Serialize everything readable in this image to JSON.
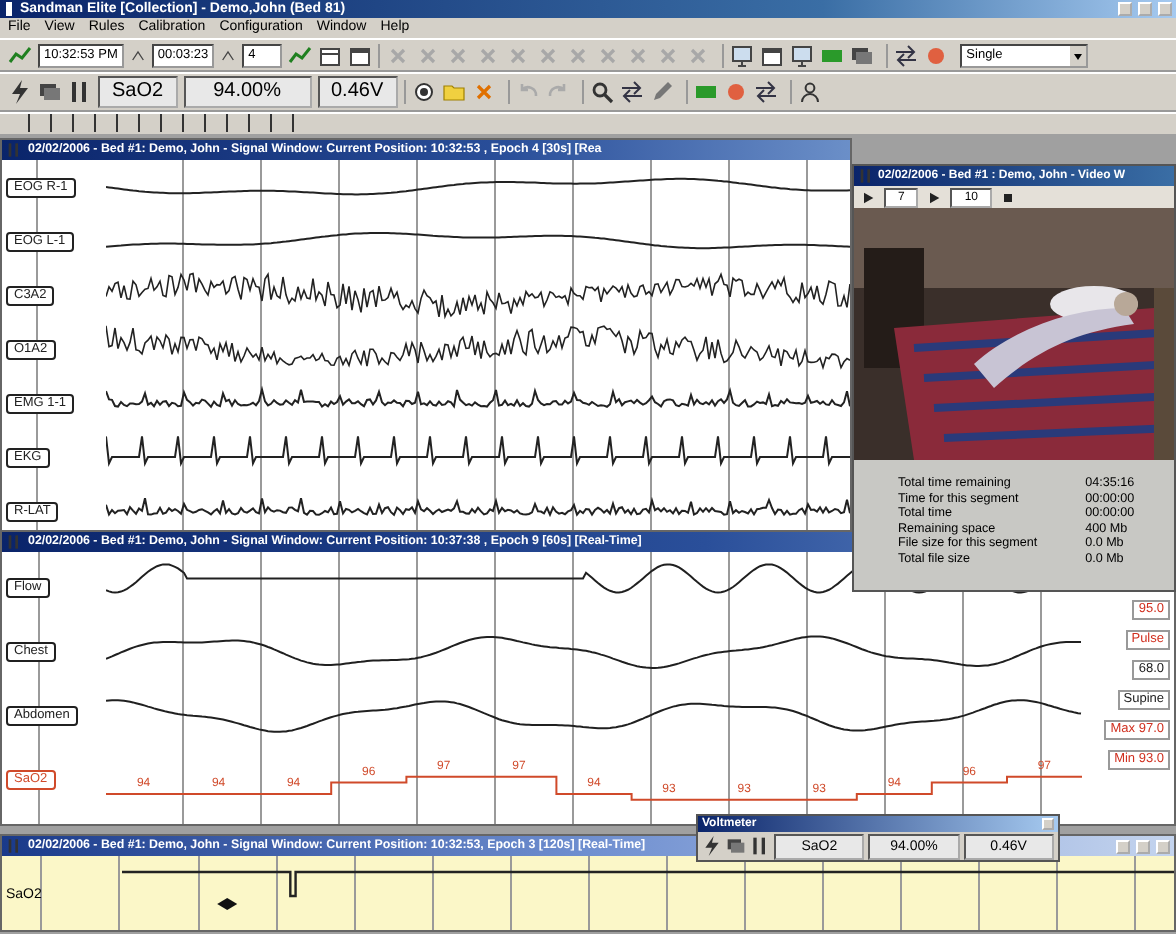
{
  "window": {
    "title": "Sandman Elite [Collection] - Demo,John (Bed 81)"
  },
  "menu": [
    "File",
    "View",
    "Rules",
    "Calibration",
    "Configuration",
    "Window",
    "Help"
  ],
  "toolbar": {
    "clock": "10:32:53 PM",
    "elapsed": "00:03:23",
    "epoch": "4",
    "layout": "Single"
  },
  "readout": {
    "channel": "SaO2",
    "value": "94.00%",
    "voltage": "0.46V"
  },
  "signal_windows": [
    {
      "title": "02/02/2006 - Bed #1: Demo, John - Signal Window: Current Position: 10:32:53 , Epoch 4 [30s] [Rea",
      "channels": [
        {
          "label": "EOG R-1",
          "kind": "eog"
        },
        {
          "label": "EOG L-1",
          "kind": "eog"
        },
        {
          "label": "C3A2",
          "kind": "eeg"
        },
        {
          "label": "O1A2",
          "kind": "eeg"
        },
        {
          "label": "EMG 1-1",
          "kind": "emg"
        },
        {
          "label": "EKG",
          "kind": "ekg"
        },
        {
          "label": "R-LAT",
          "kind": "emg"
        }
      ]
    },
    {
      "title": "02/02/2006 - Bed #1: Demo, John - Signal Window: Current Position: 10:37:38 , Epoch 9 [60s] [Real-Time]",
      "channels": [
        {
          "label": "Flow",
          "kind": "flow",
          "color": "#202020"
        },
        {
          "label": "Chest",
          "kind": "effort",
          "color": "#202020"
        },
        {
          "label": "Abdomen",
          "kind": "effort",
          "color": "#202020"
        },
        {
          "label": "SaO2",
          "kind": "trend",
          "color": "#d04a2a",
          "trend_labels": [
            "94",
            "94",
            "94",
            "96",
            "97",
            "97",
            "94",
            "93",
            "93",
            "93",
            "94",
            "96",
            "97"
          ]
        }
      ],
      "side_readouts": [
        {
          "text": "95.0",
          "color": "#d03020"
        },
        {
          "text": "Pulse",
          "color": "#d03020"
        },
        {
          "text": "68.0",
          "color": "#202020"
        },
        {
          "text": "Supine",
          "color": "#202020"
        },
        {
          "text": "Max 97.0",
          "color": "#d03020"
        },
        {
          "text": "Min 93.0",
          "color": "#d03020"
        }
      ]
    },
    {
      "title": "02/02/2006 - Bed #1: Demo, John - Signal Window: Current Position: 10:32:53, Epoch 3 [120s] [Real-Time]",
      "channels": [
        {
          "label": "SaO2",
          "kind": "strip"
        }
      ]
    }
  ],
  "video": {
    "title": "02/02/2006 - Bed #1 : Demo, John - Video W",
    "speed": "7",
    "frame": "10"
  },
  "recording_stats": [
    {
      "label": "Total time remaining",
      "value": "04:35:16"
    },
    {
      "label": "Time for this segment",
      "value": "00:00:00"
    },
    {
      "label": "Total time",
      "value": "00:00:00"
    },
    {
      "label": "Remaining space",
      "value": "400 Mb"
    },
    {
      "label": "File size for this segment",
      "value": "0.0 Mb"
    },
    {
      "label": "Total file size",
      "value": "0.0 Mb"
    }
  ],
  "voltmeter": {
    "title": "Voltmeter",
    "channel": "SaO2",
    "value": "94.00%",
    "voltage": "0.46V"
  }
}
